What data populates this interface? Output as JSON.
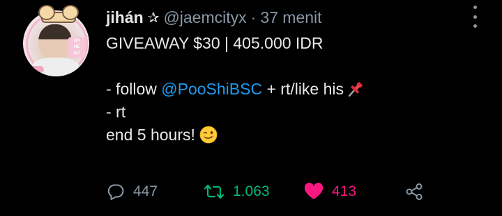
{
  "tweet": {
    "display_name": "jihán",
    "handle": "@jaemcityx",
    "separator": "·",
    "timestamp": "37 menit",
    "body": {
      "line1": "GIVEAWAY $30 | 405.000 IDR",
      "line2_prefix": "- follow ",
      "line2_mention": "@PooShiBSC",
      "line2_suffix": " + rt/like his",
      "line3": "- rt",
      "line4": "end 5 hours!"
    },
    "avatar_tag_text": "OH\nHE\nSO"
  },
  "actions": {
    "reply_count": "447",
    "retweet_count": "1.063",
    "like_count": "413"
  },
  "icons": {
    "name_badge": "star-outline-icon",
    "more": "more-vertical-icon",
    "reply": "comment-bubble-icon",
    "retweet": "retweet-icon",
    "like": "heart-filled-icon",
    "share": "share-icon",
    "pin_emoji": "pushpin-emoji",
    "wink_emoji": "winking-face-emoji"
  },
  "colors": {
    "background": "#000000",
    "text": "#e7e9ea",
    "muted": "#8b98a5",
    "mention": "#1d9bf0",
    "retweet": "#00ba7c",
    "like": "#f91880"
  }
}
